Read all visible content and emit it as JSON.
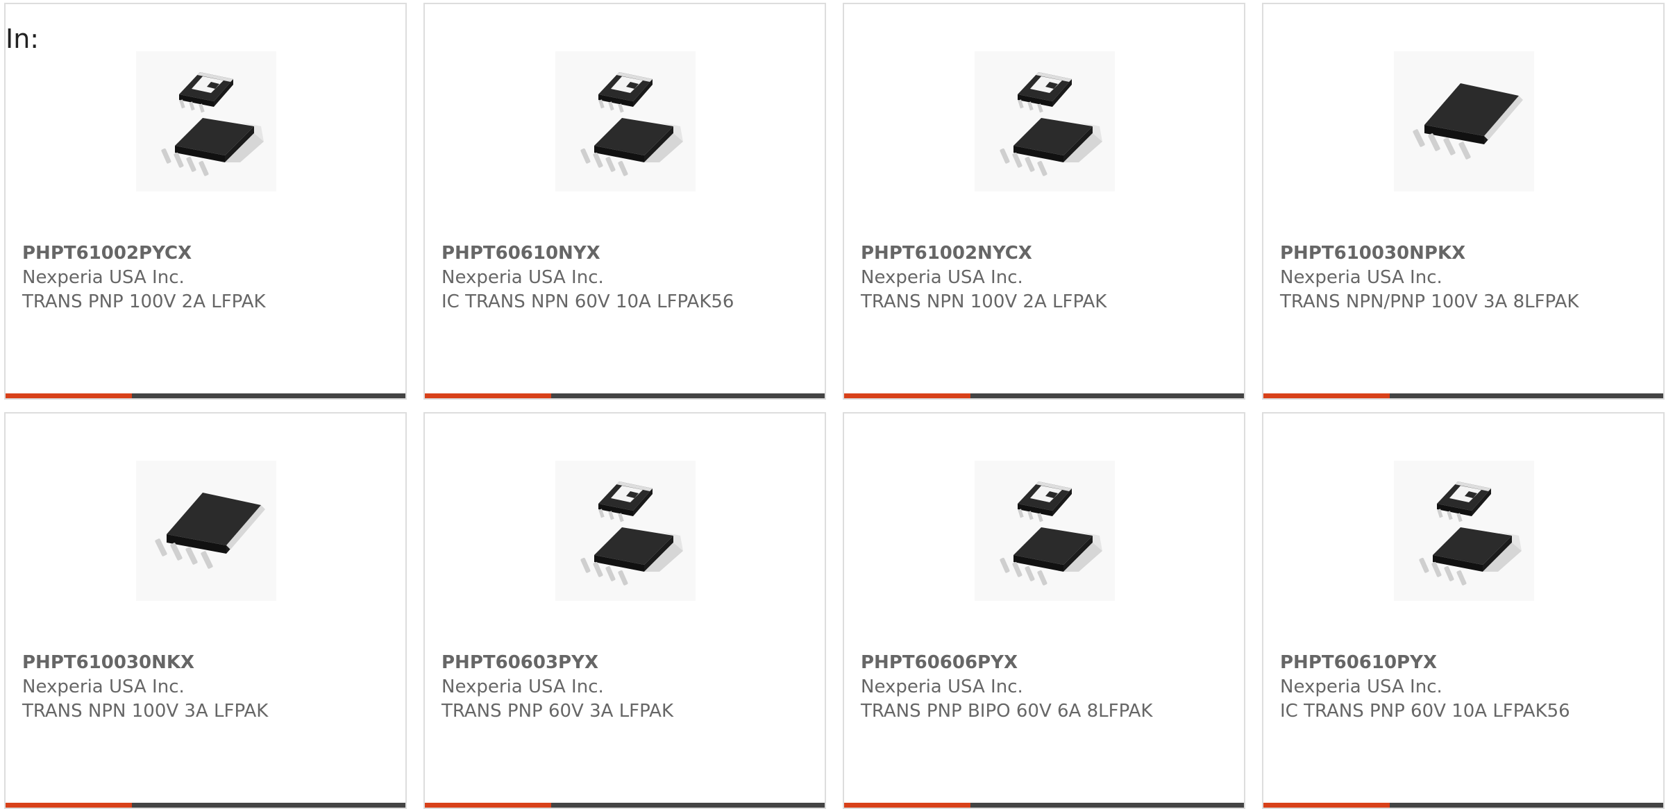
{
  "header": {
    "prefix": "In:"
  },
  "products": [
    {
      "part": "PHPT61002PYCX",
      "manufacturer": "Nexperia USA Inc.",
      "description": "TRANS PNP 100V 2A LFPAK",
      "image_icon": "lfpak-two-chip-icon"
    },
    {
      "part": "PHPT60610NYX",
      "manufacturer": "Nexperia USA Inc.",
      "description": "IC TRANS NPN 60V 10A LFPAK56",
      "image_icon": "lfpak-two-chip-icon"
    },
    {
      "part": "PHPT61002NYCX",
      "manufacturer": "Nexperia USA Inc.",
      "description": "TRANS NPN 100V 2A LFPAK",
      "image_icon": "lfpak-two-chip-icon"
    },
    {
      "part": "PHPT610030NPKX",
      "manufacturer": "Nexperia USA Inc.",
      "description": "TRANS NPN/PNP 100V 3A 8LFPAK",
      "image_icon": "lfpak-single-chip-icon"
    },
    {
      "part": "PHPT610030NKX",
      "manufacturer": "Nexperia USA Inc.",
      "description": "TRANS NPN 100V 3A LFPAK",
      "image_icon": "lfpak-single-chip-icon"
    },
    {
      "part": "PHPT60603PYX",
      "manufacturer": "Nexperia USA Inc.",
      "description": "TRANS PNP 60V 3A LFPAK",
      "image_icon": "lfpak-two-chip-icon"
    },
    {
      "part": "PHPT60606PYX",
      "manufacturer": "Nexperia USA Inc.",
      "description": "TRANS PNP BIPO 60V 6A 8LFPAK",
      "image_icon": "lfpak-two-chip-icon"
    },
    {
      "part": "PHPT60610PYX",
      "manufacturer": "Nexperia USA Inc.",
      "description": "IC TRANS PNP 60V 10A LFPAK56",
      "image_icon": "lfpak-two-chip-icon"
    }
  ],
  "colors": {
    "accent": "#d8411a",
    "bar": "#444444",
    "text": "#666666",
    "border": "#dddddd"
  }
}
